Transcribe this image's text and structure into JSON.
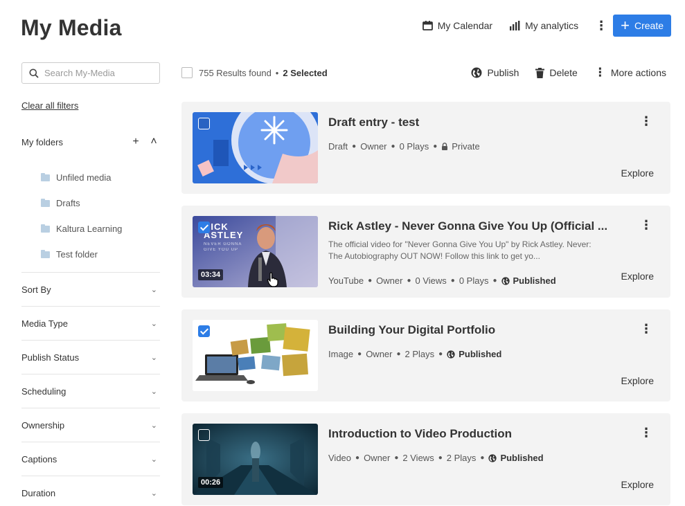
{
  "header": {
    "title": "My Media",
    "calendar_label": "My Calendar",
    "analytics_label": "My analytics",
    "create_label": "Create"
  },
  "sidebar": {
    "search_placeholder": "Search My-Media",
    "clear_filters": "Clear all filters",
    "folders_title": "My folders",
    "folders": [
      {
        "label": "Unfiled media"
      },
      {
        "label": "Drafts"
      },
      {
        "label": "Kaltura Learning"
      },
      {
        "label": "Test folder"
      }
    ],
    "filters": [
      {
        "label": "Sort By"
      },
      {
        "label": "Media Type"
      },
      {
        "label": "Publish Status"
      },
      {
        "label": "Scheduling"
      },
      {
        "label": "Ownership"
      },
      {
        "label": "Captions"
      },
      {
        "label": "Duration"
      }
    ]
  },
  "results": {
    "count_text": "755 Results found",
    "selected_text": "2 Selected",
    "publish_label": "Publish",
    "delete_label": "Delete",
    "more_actions_label": "More actions"
  },
  "entries": [
    {
      "title": "Draft entry - test",
      "type": "Draft",
      "owner": "Owner",
      "plays": "0 Plays",
      "status": "Private",
      "explore": "Explore",
      "checked": false
    },
    {
      "title": "Rick Astley - Never Gonna Give You Up (Official ...",
      "description": "The official video for \"Never Gonna Give You Up\" by Rick Astley. Never: The Autobiography OUT NOW! Follow this link to get yo...",
      "type": "YouTube",
      "owner": "Owner",
      "views": "0 Views",
      "plays": "0 Plays",
      "status": "Published",
      "duration": "03:34",
      "thumb_text_line1": "RICK",
      "thumb_text_line2": "ASTLEY",
      "thumb_small1": "NEVER GONNA",
      "thumb_small2": "GIVE YOU UP",
      "explore": "Explore",
      "checked": true
    },
    {
      "title": "Building Your Digital Portfolio",
      "type": "Image",
      "owner": "Owner",
      "plays": "2 Plays",
      "status": "Published",
      "explore": "Explore",
      "checked": true
    },
    {
      "title": "Introduction to Video Production",
      "type": "Video",
      "owner": "Owner",
      "views": "2 Views",
      "plays": "2 Plays",
      "status": "Published",
      "duration": "00:26",
      "explore": "Explore",
      "checked": false
    }
  ],
  "colors": {
    "accent": "#2d7de6",
    "card_bg": "#f3f3f3"
  }
}
